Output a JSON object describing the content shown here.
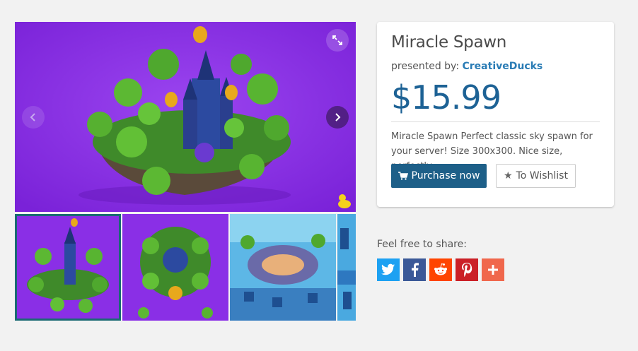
{
  "product": {
    "title": "Miracle Spawn",
    "presented_by_label": "presented by:",
    "author": "CreativeDucks",
    "price": "$15.99",
    "description": "Miracle Spawn Perfect classic sky spawn for your server! Size 300x300. Nice size, perfectly...",
    "purchase_label": "Purchase now",
    "wishlist_label": "To Wishlist"
  },
  "gallery": {
    "main_image": "floating-castle-island",
    "thumbnails": [
      "floating-castle-island",
      "round-island-top-view",
      "spawn-plaza-view",
      "blue-blocks-partial"
    ],
    "active_thumbnail": 0
  },
  "share": {
    "label": "Feel free to share:",
    "buttons": [
      {
        "name": "twitter",
        "color": "#1da1f2"
      },
      {
        "name": "facebook",
        "color": "#3b5998"
      },
      {
        "name": "reddit",
        "color": "#ff4500"
      },
      {
        "name": "pinterest",
        "color": "#cb2027"
      },
      {
        "name": "more",
        "color": "#f0674c"
      }
    ]
  },
  "colors": {
    "background": "#f2f2f2",
    "accent": "#1d5f88",
    "price": "#1d6295",
    "link": "#2a7cb5",
    "image_bg": "#8a2fe6"
  }
}
